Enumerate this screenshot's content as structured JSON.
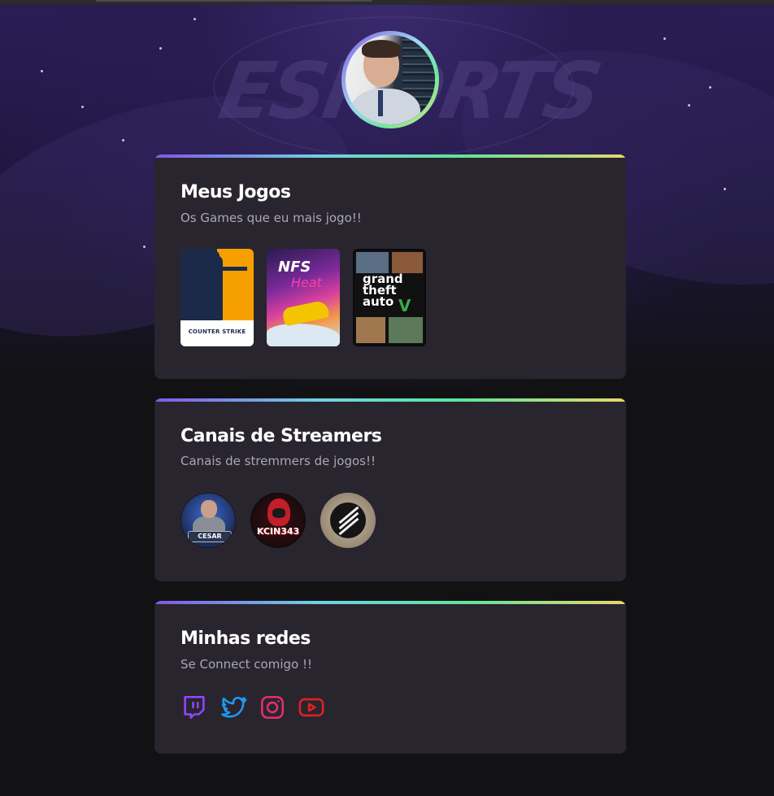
{
  "hero": {
    "background_watermark": "ESPORTS"
  },
  "profile": {
    "avatar_alt": "Foto de perfil"
  },
  "games_card": {
    "title": "Meus Jogos",
    "subtitle": "Os Games que eu mais jogo!!",
    "items": [
      {
        "name": "Counter-Strike",
        "cover_text": "COUNTER STRIKE"
      },
      {
        "name": "Need for Speed Heat",
        "cover_text": "NFS",
        "cover_subtext": "Heat"
      },
      {
        "name": "Grand Theft Auto V",
        "cover_text": "grand theft auto",
        "cover_subtext": "V"
      }
    ]
  },
  "streamers_card": {
    "title": "Canais de Streamers",
    "subtitle": "Canais de stremmers de jogos!!",
    "items": [
      {
        "name": "Cesar",
        "badge_text": "CESAR"
      },
      {
        "name": "Kcin343",
        "badge_text": "KCIN343"
      },
      {
        "name": "ESL"
      }
    ]
  },
  "social_card": {
    "title": "Minhas redes",
    "subtitle": "Se Connect comigo !!",
    "links": [
      {
        "name": "Twitch",
        "icon": "twitch-icon",
        "color": "#9146ff"
      },
      {
        "name": "Twitter",
        "icon": "twitter-icon",
        "color": "#1d9bf0"
      },
      {
        "name": "Instagram",
        "icon": "instagram-icon",
        "color": "#e1306c"
      },
      {
        "name": "YouTube",
        "icon": "youtube-icon",
        "color": "#e02020"
      }
    ]
  },
  "theme": {
    "accent_gradient": [
      "#8257e5",
      "#6fd2e4",
      "#5ee59a",
      "#e7d86a"
    ],
    "card_background": "#29252f",
    "page_background": "#121214"
  }
}
